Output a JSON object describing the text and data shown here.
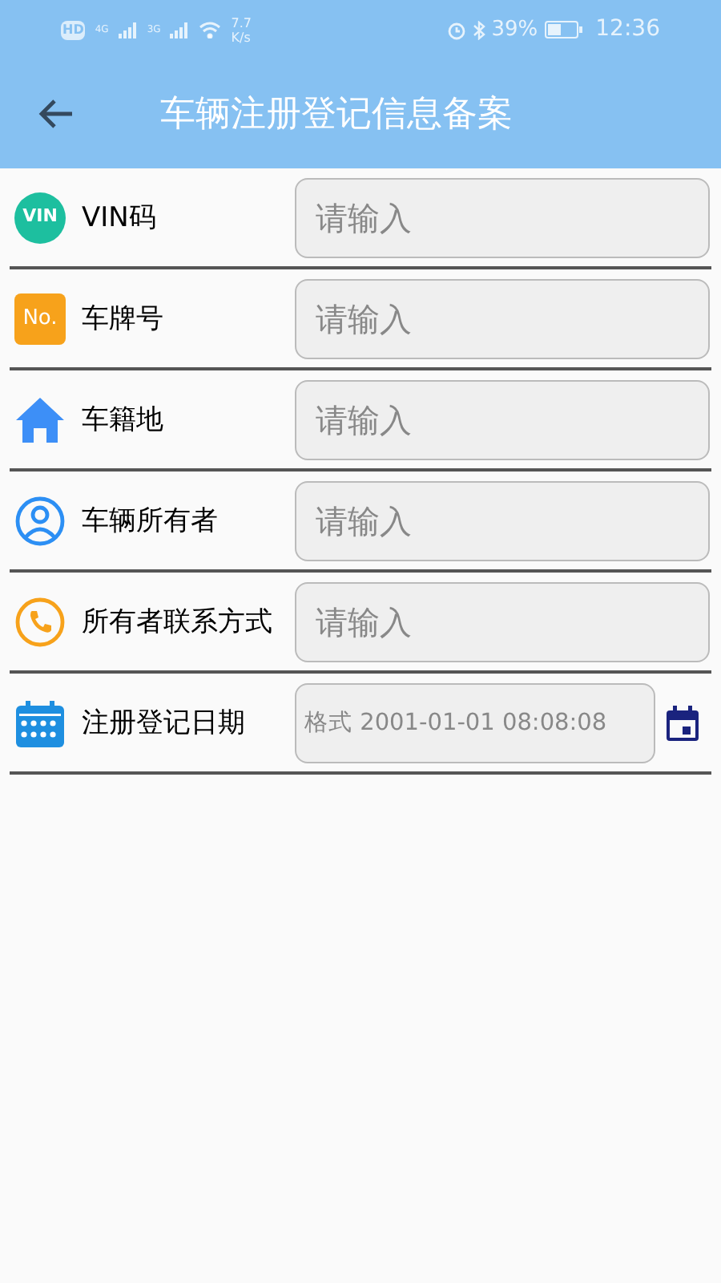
{
  "status_bar": {
    "hd": "HD",
    "net_1": "4G",
    "net_2": "3G",
    "speed_value": "7.7",
    "speed_unit": "K/s",
    "battery": "39%",
    "time": "12:36"
  },
  "title": "车辆注册登记信息备案",
  "fields": [
    {
      "kind": "text",
      "badge": "VIN",
      "label": "VIN码",
      "placeholder": "请输入"
    },
    {
      "kind": "text",
      "badge": "No.",
      "label": "车牌号",
      "placeholder": "请输入"
    },
    {
      "kind": "text",
      "label": "车籍地",
      "placeholder": "请输入"
    },
    {
      "kind": "text",
      "label": "车辆所有者",
      "placeholder": "请输入"
    },
    {
      "kind": "text",
      "label": "所有者联系方式",
      "placeholder": "请输入"
    },
    {
      "kind": "date",
      "label": "注册登记日期",
      "placeholder": "格式 2001-01-01 08:08:08"
    }
  ]
}
